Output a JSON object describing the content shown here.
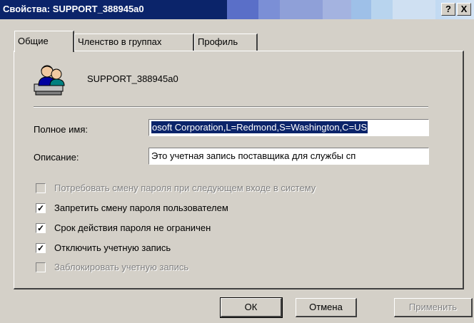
{
  "window": {
    "title": "Свойства: SUPPORT_388945a0",
    "help_button": "?",
    "close_button": "X"
  },
  "tabs": [
    {
      "label": "Общие",
      "active": true
    },
    {
      "label": "Членство в группах",
      "active": false
    },
    {
      "label": "Профиль",
      "active": false
    }
  ],
  "general": {
    "user_icon": "users-icon",
    "username": "SUPPORT_388945a0",
    "full_name_label": "Полное имя:",
    "full_name_value": "osoft Corporation,L=Redmond,S=Washington,C=US",
    "description_label": "Описание:",
    "description_value": "Это учетная запись поставщика для службы сп"
  },
  "checkboxes": [
    {
      "label": "Потребовать смену пароля при следующем входе в систему",
      "checked": false,
      "enabled": false
    },
    {
      "label": "Запретить смену пароля пользователем",
      "checked": true,
      "enabled": true
    },
    {
      "label": "Срок действия пароля не ограничен",
      "checked": true,
      "enabled": true
    },
    {
      "label": "Отключить учетную запись",
      "checked": true,
      "enabled": true
    },
    {
      "label": "Заблокировать учетную запись",
      "checked": false,
      "enabled": false
    }
  ],
  "buttons": {
    "ok": "ОК",
    "cancel": "Отмена",
    "apply": "Применить"
  }
}
